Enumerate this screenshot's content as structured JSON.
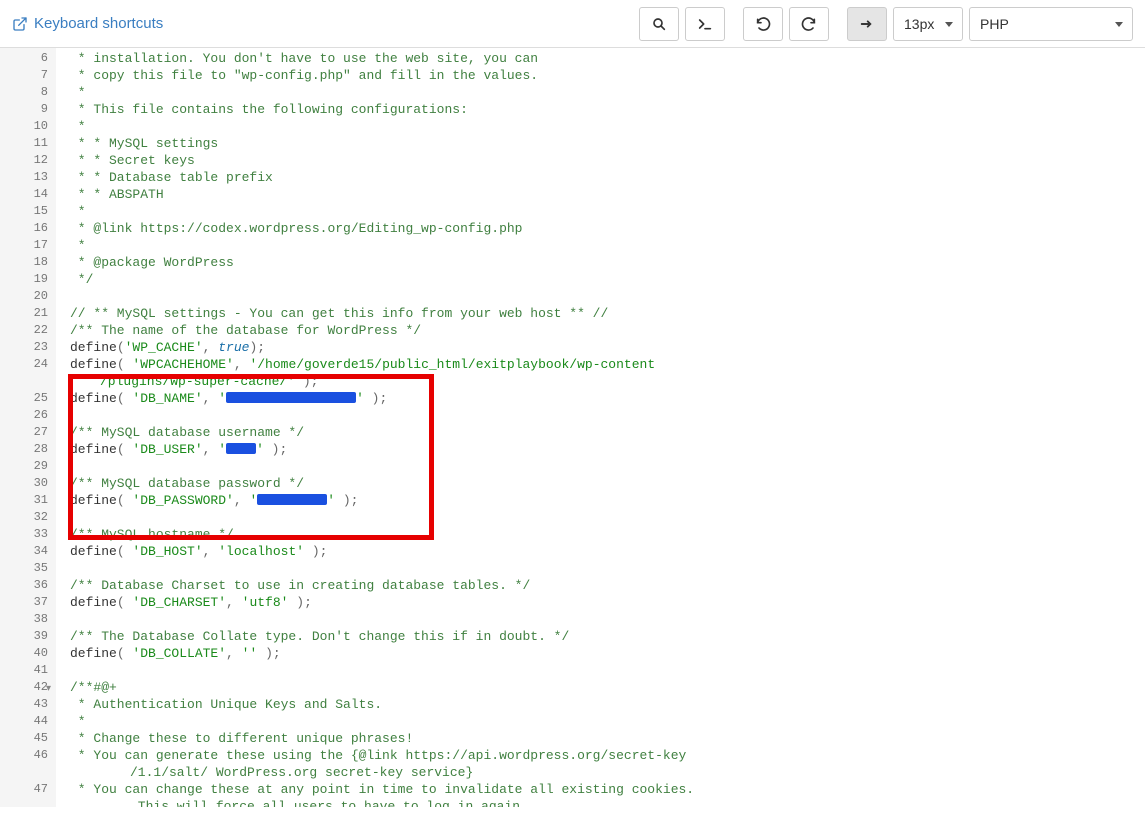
{
  "toolbar": {
    "keyboard_shortcuts_label": "Keyboard shortcuts",
    "font_size_label": "13px",
    "language_label": "PHP"
  },
  "gutter": {
    "start": 6,
    "end": 47
  },
  "highlight_box": {
    "present": true
  },
  "code_lines": [
    {
      "n": 6,
      "type": "comment",
      "text": " * installation. You don't have to use the web site, you can"
    },
    {
      "n": 7,
      "type": "comment",
      "text": " * copy this file to \"wp-config.php\" and fill in the values."
    },
    {
      "n": 8,
      "type": "comment",
      "text": " *"
    },
    {
      "n": 9,
      "type": "comment",
      "text": " * This file contains the following configurations:"
    },
    {
      "n": 10,
      "type": "comment",
      "text": " *"
    },
    {
      "n": 11,
      "type": "comment",
      "text": " * * MySQL settings"
    },
    {
      "n": 12,
      "type": "comment",
      "text": " * * Secret keys"
    },
    {
      "n": 13,
      "type": "comment",
      "text": " * * Database table prefix"
    },
    {
      "n": 14,
      "type": "comment",
      "text": " * * ABSPATH"
    },
    {
      "n": 15,
      "type": "comment",
      "text": " *"
    },
    {
      "n": 16,
      "type": "comment",
      "text": " * @link https://codex.wordpress.org/Editing_wp-config.php"
    },
    {
      "n": 17,
      "type": "comment",
      "text": " *"
    },
    {
      "n": 18,
      "type": "comment",
      "text": " * @package WordPress"
    },
    {
      "n": 19,
      "type": "comment",
      "text": " */"
    },
    {
      "n": 20,
      "type": "blank",
      "text": ""
    },
    {
      "n": 21,
      "type": "comment",
      "text": "// ** MySQL settings - You can get this info from your web host ** //"
    },
    {
      "n": 22,
      "type": "comment",
      "text": "/** The name of the database for WordPress */"
    },
    {
      "n": 23,
      "type": "define",
      "func": "define",
      "const": "'WP_CACHE'",
      "sep": ", ",
      "value_keyword": "true",
      "tail": ");"
    },
    {
      "n": 24,
      "type": "define_str_wrap",
      "func": "define",
      "const": "'WPCACHEHOME'",
      "sep": ", ",
      "value": "'/home/goverde15/public_html/exitplaybook/wp-content",
      "wrap_value": "/plugins/wp-super-cache/'",
      "wrap_tail": " );"
    },
    {
      "n": 25,
      "type": "define_redact",
      "func": "define",
      "const": "'DB_NAME'",
      "sep": ", ",
      "pre_quote": "'",
      "redact_w": 130,
      "post_quote": "'",
      "tail": " );"
    },
    {
      "n": 26,
      "type": "blank",
      "text": ""
    },
    {
      "n": 27,
      "type": "comment",
      "text": "/** MySQL database username */"
    },
    {
      "n": 28,
      "type": "define_redact",
      "func": "define",
      "const": "'DB_USER'",
      "sep": ", ",
      "pre_quote": "'",
      "redact_w": 30,
      "post_quote": "'",
      "tail": " );"
    },
    {
      "n": 29,
      "type": "blank",
      "text": ""
    },
    {
      "n": 30,
      "type": "comment",
      "text": "/** MySQL database password */"
    },
    {
      "n": 31,
      "type": "define_redact",
      "func": "define",
      "const": "'DB_PASSWORD'",
      "sep": ", ",
      "pre_quote": "'",
      "redact_w": 70,
      "post_quote": "'",
      "tail": " );"
    },
    {
      "n": 32,
      "type": "blank",
      "text": ""
    },
    {
      "n": 33,
      "type": "comment",
      "text": "/** MySQL hostname */"
    },
    {
      "n": 34,
      "type": "define_str",
      "func": "define",
      "const": "'DB_HOST'",
      "sep": ", ",
      "value": "'localhost'",
      "tail": " );"
    },
    {
      "n": 35,
      "type": "blank",
      "text": ""
    },
    {
      "n": 36,
      "type": "comment",
      "text": "/** Database Charset to use in creating database tables. */"
    },
    {
      "n": 37,
      "type": "define_str",
      "func": "define",
      "const": "'DB_CHARSET'",
      "sep": ", ",
      "value": "'utf8'",
      "tail": " );"
    },
    {
      "n": 38,
      "type": "blank",
      "text": ""
    },
    {
      "n": 39,
      "type": "comment",
      "text": "/** The Database Collate type. Don't change this if in doubt. */"
    },
    {
      "n": 40,
      "type": "define_str",
      "func": "define",
      "const": "'DB_COLLATE'",
      "sep": ", ",
      "value": "''",
      "tail": " );"
    },
    {
      "n": 41,
      "type": "blank",
      "text": ""
    },
    {
      "n": 42,
      "type": "comment",
      "text": "/**#@+",
      "fold": true
    },
    {
      "n": 43,
      "type": "comment",
      "text": " * Authentication Unique Keys and Salts."
    },
    {
      "n": 44,
      "type": "comment",
      "text": " *"
    },
    {
      "n": 45,
      "type": "comment",
      "text": " * Change these to different unique phrases!"
    },
    {
      "n": 46,
      "type": "comment_wrap",
      "text": " * You can generate these using the {@link https://api.wordpress.org/secret-key",
      "wrap": "/1.1/salt/ WordPress.org secret-key service}"
    },
    {
      "n": 47,
      "type": "comment_wrap",
      "text": " * You can change these at any point in time to invalidate all existing cookies.",
      "wrap": " This will force all users to have to log in again "
    }
  ]
}
